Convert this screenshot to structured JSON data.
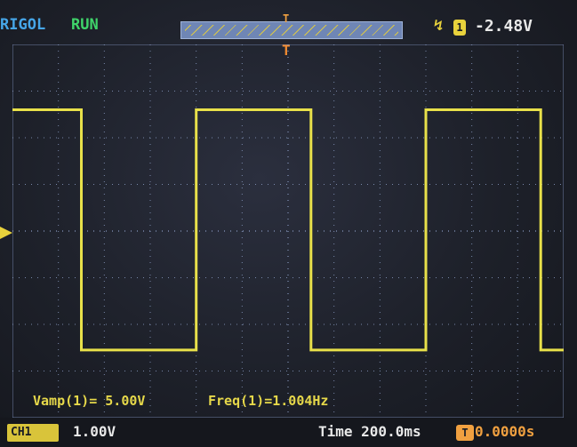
{
  "header": {
    "brand": "RIGOL",
    "run_state": "RUN",
    "trigger_edge_icon": "rising-edge-icon",
    "trigger_source": "1",
    "trigger_level": "-2.48V"
  },
  "screen": {
    "trigger_position_marker": "T",
    "channel_marker_icon": "channel-1-ground-marker-icon",
    "waveform": {
      "color": "#e8e04a",
      "high_div": 2.6,
      "low_div": -2.55,
      "transitions_div": [
        1.5,
        4.0,
        6.5,
        9.0,
        11.5
      ]
    },
    "grid": {
      "h_div": 12,
      "v_div": 8
    }
  },
  "measurements": {
    "amplitude": "Vamp(1)= 5.00V",
    "frequency": "Freq(1)=1.004Hz"
  },
  "footer": {
    "channel_badge": "CH1",
    "channel_scale": "1.00V",
    "timebase": "Time 200.0ms",
    "offset_badge": "T",
    "offset": "0.0000s"
  },
  "colors": {
    "brand": "#46a6e8",
    "run": "#3fd46a",
    "trace": "#e8e04a",
    "trigger": "#f0a040",
    "grid": "#8ea0c8"
  }
}
